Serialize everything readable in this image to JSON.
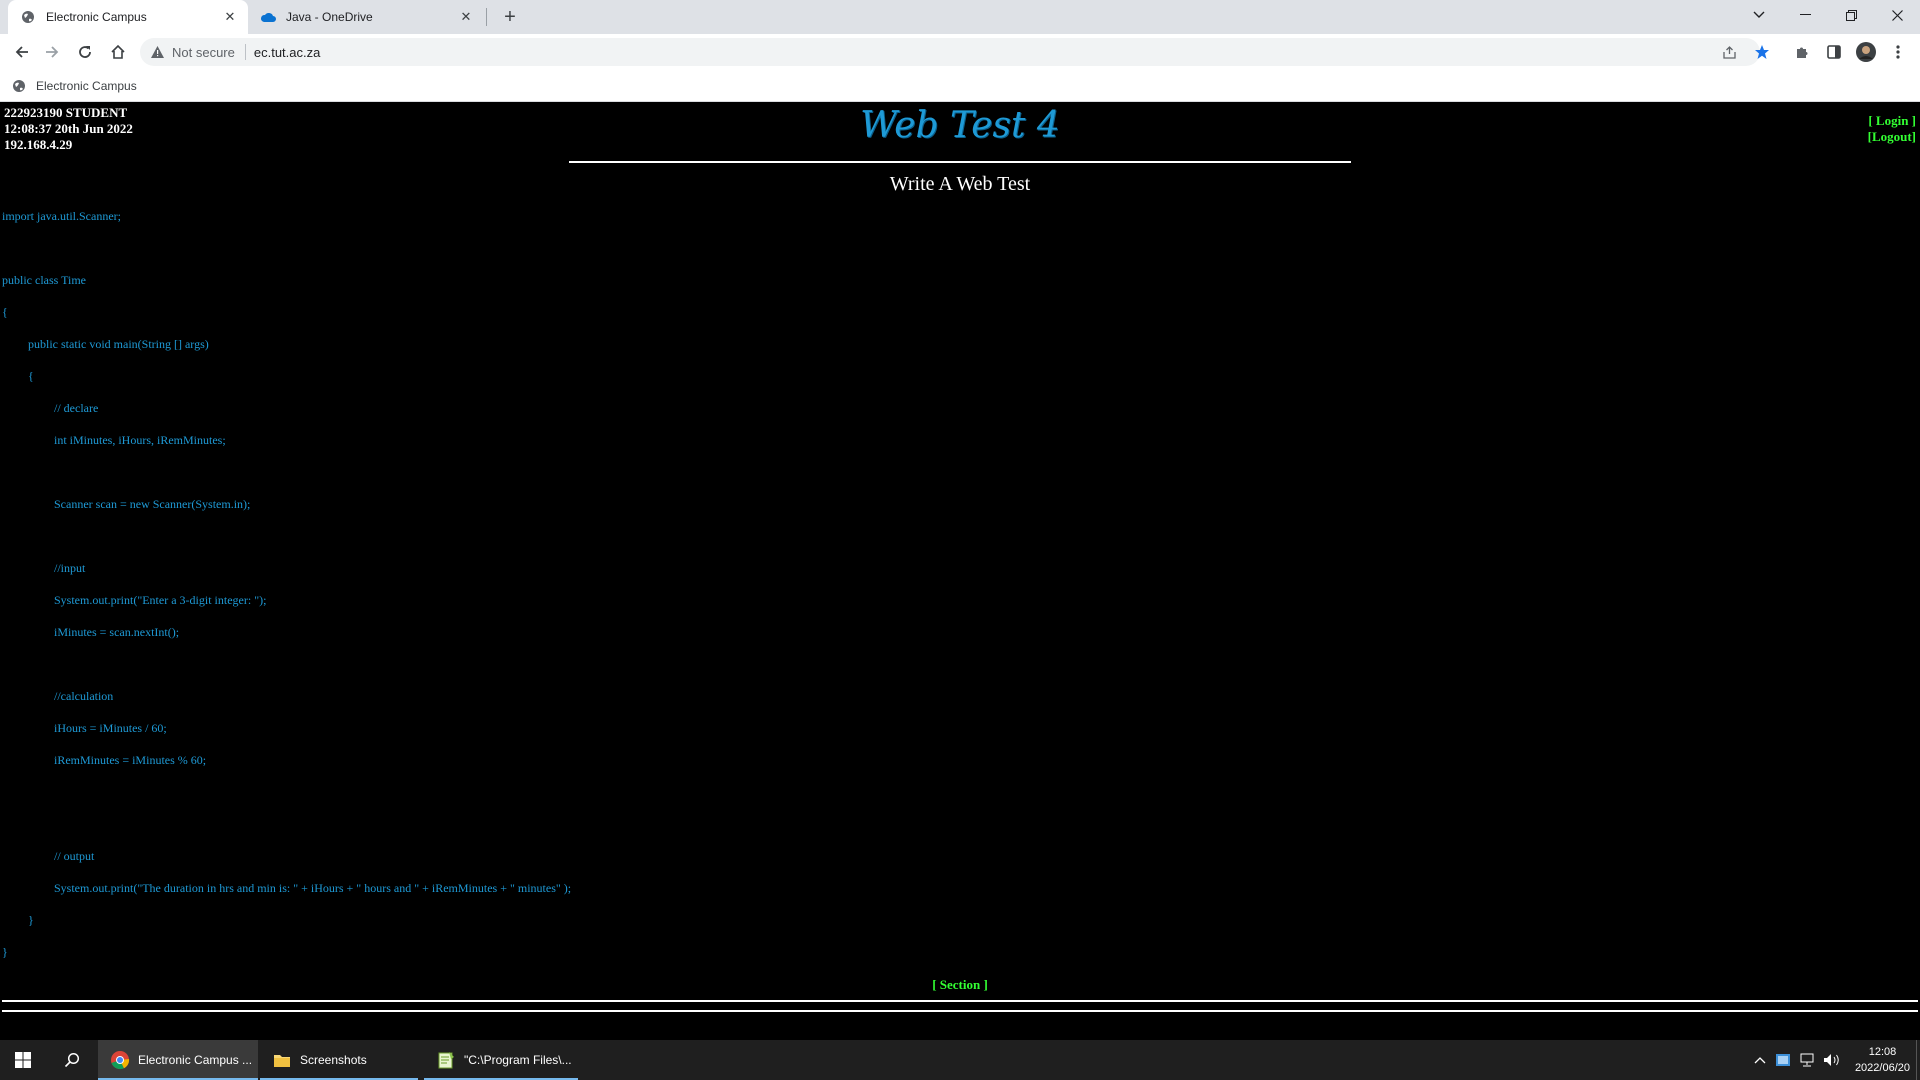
{
  "browser": {
    "tabs": [
      {
        "title": "Electronic Campus",
        "active": true,
        "icon": "globe-icon"
      },
      {
        "title": "Java - OneDrive",
        "active": false,
        "icon": "onedrive-cloud-icon"
      }
    ],
    "address": {
      "security_label": "Not secure",
      "url": "ec.tut.ac.za"
    },
    "bookmarks": [
      {
        "label": "Electronic Campus",
        "icon": "globe-icon"
      }
    ]
  },
  "page": {
    "user_info": {
      "line1": "222923190 STUDENT",
      "line2": "12:08:37 20th Jun 2022",
      "line3": "192.168.4.29"
    },
    "login_label": "[ Login ]",
    "logout_label": "[Logout]",
    "title": "Web Test 4",
    "subtitle": "Write A Web Test",
    "section_link": "[ Section ]",
    "code_lines": [
      {
        "text": "import java.util.Scanner;",
        "indent": 0
      },
      {
        "text": "public class Time",
        "indent": 0
      },
      {
        "text": "{",
        "indent": 0
      },
      {
        "text": "public static void main(String [] args)",
        "indent": 1
      },
      {
        "text": "{",
        "indent": 1
      },
      {
        "text": "// declare",
        "indent": 2
      },
      {
        "text": "int iMinutes, iHours, iRemMinutes;",
        "indent": 2
      },
      {
        "text": "Scanner scan = new Scanner(System.in);",
        "indent": 2
      },
      {
        "text": "//input",
        "indent": 2
      },
      {
        "text": "System.out.print(\"Enter a 3-digit integer: \");",
        "indent": 2
      },
      {
        "text": "iMinutes = scan.nextInt();",
        "indent": 2
      },
      {
        "text": "//calculation",
        "indent": 2
      },
      {
        "text": "iHours = iMinutes / 60;",
        "indent": 2
      },
      {
        "text": "iRemMinutes = iMinutes % 60;",
        "indent": 2
      },
      {
        "text": "// output",
        "indent": 2
      },
      {
        "text": "System.out.print(\"The duration in hrs and min is: \" + iHours + \" hours and \" + iRemMinutes + \" minutes\" );",
        "indent": 2
      },
      {
        "text": "}",
        "indent": 1
      },
      {
        "text": "}",
        "indent": 0
      }
    ]
  },
  "taskbar": {
    "apps": [
      {
        "label": "Electronic Campus ...",
        "icon": "chrome-icon",
        "active": true
      },
      {
        "label": "Screenshots",
        "icon": "folder-icon",
        "active": false
      },
      {
        "label": "\"C:\\Program Files\\...",
        "icon": "notepadpp-icon",
        "active": false
      }
    ],
    "clock": {
      "time": "12:08",
      "date": "2022/06/20"
    }
  },
  "colors": {
    "code_blue": "#1e9ad6",
    "link_green": "#33ff33",
    "page_bg": "#000000"
  }
}
